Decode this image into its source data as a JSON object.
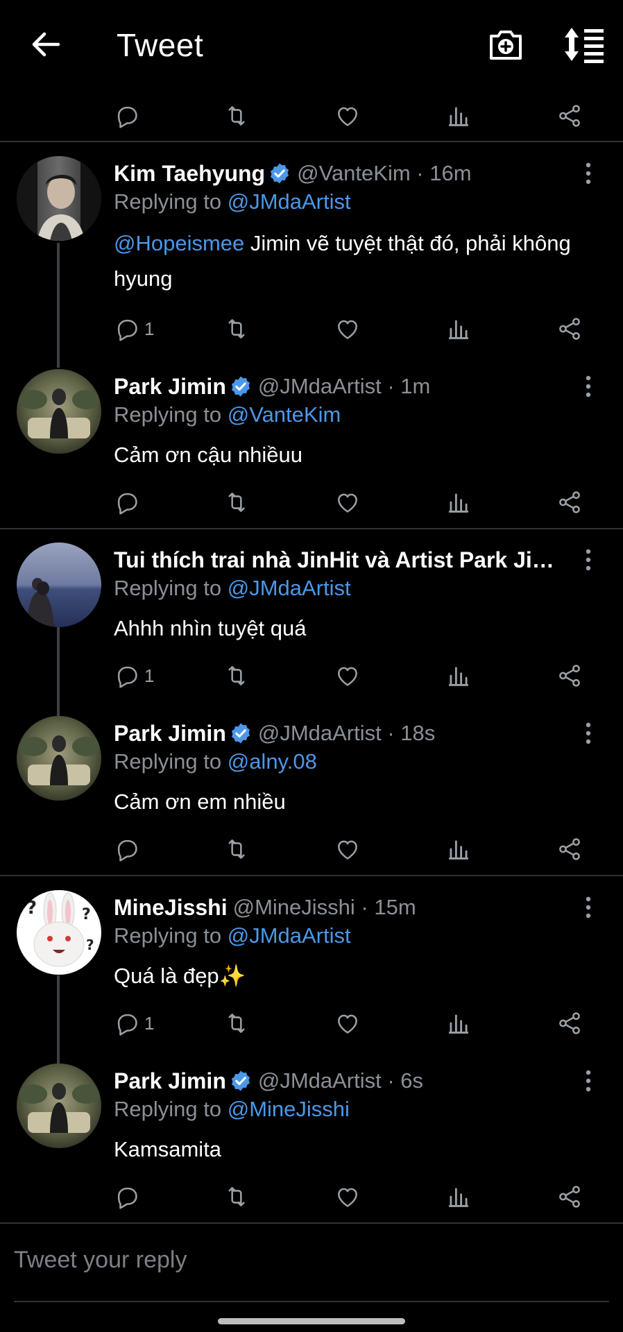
{
  "header": {
    "title": "Tweet",
    "icons": [
      "back-arrow-icon",
      "camera-plus-icon",
      "sort-icon"
    ]
  },
  "colors": {
    "background": "#000000",
    "link": "#4b98e8",
    "muted": "#8b9097",
    "divider": "#2f3336",
    "verified": "#4b98e8"
  },
  "main_actions": {
    "reply_count": "",
    "retweet_count": "",
    "like_count": ""
  },
  "tweets": [
    {
      "name": "Kim Taehyung",
      "verified": true,
      "handle": "@VanteKim · 16m",
      "reply_prefix": "Replying to",
      "reply_to": "@JMdaArtist",
      "mention": "@Hopeismee",
      "text": " Jimin vẽ tuyệt thật đó, phải không hyung",
      "reply_count": "1"
    },
    {
      "name": "Park Jimin",
      "verified": true,
      "handle": "@JMdaArtist · 1m",
      "reply_prefix": "Replying to",
      "reply_to": "@VanteKim",
      "text": "Cảm ơn cậu nhiềuu",
      "reply_count": ""
    },
    {
      "name": "Tui thích trai nhà JinHit và Artist Park Jimin ...",
      "verified": false,
      "handle": "",
      "reply_prefix": "Replying to",
      "reply_to": "@JMdaArtist",
      "text": "Ahhh nhìn tuyệt quá",
      "reply_count": "1"
    },
    {
      "name": "Park Jimin",
      "verified": true,
      "handle": "@JMdaArtist · 18s",
      "reply_prefix": "Replying to",
      "reply_to": "@alny.08",
      "text": "Cảm ơn em nhiều",
      "reply_count": ""
    },
    {
      "name": "MineJisshi",
      "verified": false,
      "handle": "@MineJisshi · 15m",
      "reply_prefix": "Replying to",
      "reply_to": "@JMdaArtist",
      "text": "Quá là đẹp✨",
      "reply_count": "1"
    },
    {
      "name": "Park Jimin",
      "verified": true,
      "handle": "@JMdaArtist · 6s",
      "reply_prefix": "Replying to",
      "reply_to": "@MineJisshi",
      "text": "Kamsamita",
      "reply_count": ""
    }
  ],
  "compose": {
    "placeholder": "Tweet your reply"
  }
}
